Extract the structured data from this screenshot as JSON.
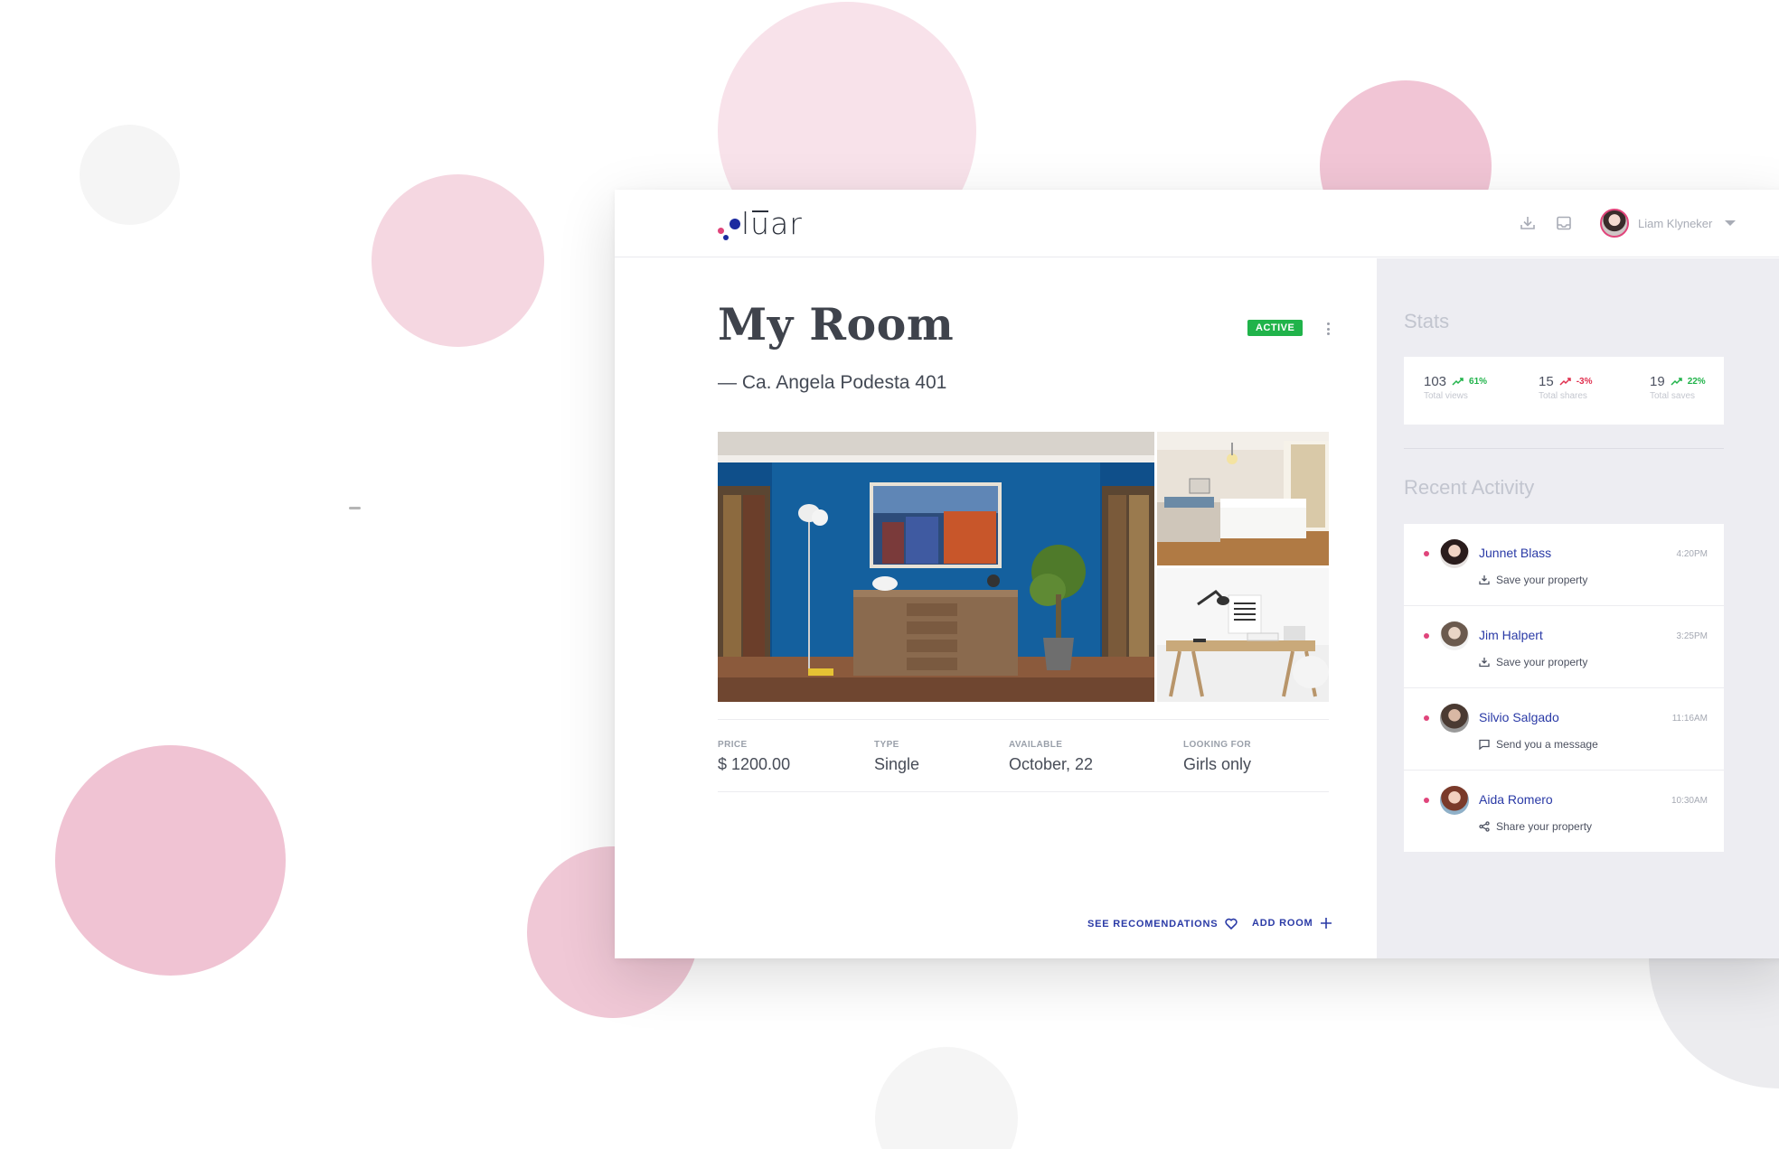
{
  "app": {
    "brand": "luar"
  },
  "header": {
    "user_name": "Liam Klyneker"
  },
  "listing": {
    "title": "My Room",
    "status": "ACTIVE",
    "address": "— Ca. Angela Podesta 401",
    "specs": [
      {
        "label": "PRICE",
        "value": "$ 1200.00"
      },
      {
        "label": "TYPE",
        "value": "Single"
      },
      {
        "label": "AVAILABLE",
        "value": "October, 22"
      },
      {
        "label": "LOOKING FOR",
        "value": "Girls only"
      }
    ],
    "actions": {
      "recommendations": "SEE RECOMENDATIONS",
      "add_room": "ADD ROOM"
    }
  },
  "sidebar": {
    "stats_title": "Stats",
    "stats": [
      {
        "value": "103",
        "change": "61%",
        "trend": "up",
        "label": "Total views"
      },
      {
        "value": "15",
        "change": "-3%",
        "trend": "down",
        "label": "Total shares"
      },
      {
        "value": "19",
        "change": "22%",
        "trend": "up",
        "label": "Total saves"
      }
    ],
    "activity_title": "Recent Activity",
    "activity": [
      {
        "name": "Junnet Blass",
        "time": "4:20PM",
        "action": "Save your property",
        "icon": "download-icon"
      },
      {
        "name": "Jim Halpert",
        "time": "3:25PM",
        "action": "Save your property",
        "icon": "download-icon"
      },
      {
        "name": "Silvio Salgado",
        "time": "11:16AM",
        "action": "Send you a message",
        "icon": "message-icon"
      },
      {
        "name": "Aida Romero",
        "time": "10:30AM",
        "action": "Share your property",
        "icon": "share-icon"
      }
    ]
  },
  "colors": {
    "accent": "#2a3aa6",
    "brand_pink": "#e0457b",
    "active_green": "#20b34a",
    "trend_up": "#20b34a",
    "trend_down": "#e0304f",
    "sidebar_bg": "#ededf2"
  }
}
